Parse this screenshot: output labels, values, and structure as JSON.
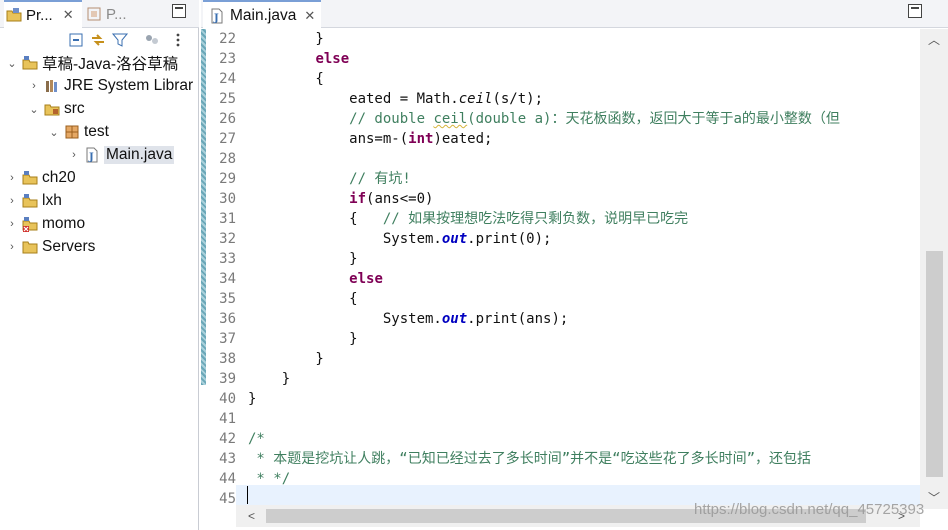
{
  "left_panel": {
    "tabs": [
      {
        "label": "Pr...",
        "icon": "project-explorer-icon",
        "close": "✕"
      },
      {
        "label": "P...",
        "icon": "package-explorer-icon"
      }
    ],
    "toolbar": [
      "collapse-all-icon",
      "link-with-editor-icon",
      "filter-icon",
      "focus-icon",
      "view-menu-icon"
    ],
    "tree": [
      {
        "label": "草稿-Java-洛谷草稿",
        "expanded": true,
        "icon": "java-project-icon"
      },
      {
        "label": "JRE System Librar",
        "expanded": false,
        "icon": "library-icon"
      },
      {
        "label": "src",
        "expanded": true,
        "icon": "source-folder-icon"
      },
      {
        "label": "test",
        "expanded": true,
        "icon": "package-icon"
      },
      {
        "label": "Main.java",
        "expanded": false,
        "icon": "java-file-icon",
        "selected": true
      },
      {
        "label": "ch20",
        "expanded": false,
        "icon": "java-project-icon"
      },
      {
        "label": "lxh",
        "expanded": false,
        "icon": "java-project-icon"
      },
      {
        "label": "momo",
        "expanded": false,
        "icon": "java-project-error-icon"
      },
      {
        "label": "Servers",
        "expanded": false,
        "icon": "folder-icon"
      }
    ]
  },
  "editor": {
    "tab": {
      "label": "Main.java",
      "close": "✕",
      "icon": "java-file-icon"
    },
    "lines": [
      {
        "n": "22",
        "tokens": [
          {
            "t": "        }"
          }
        ]
      },
      {
        "n": "23",
        "tokens": [
          {
            "t": "        "
          },
          {
            "t": "else",
            "c": "kw"
          }
        ]
      },
      {
        "n": "24",
        "tokens": [
          {
            "t": "        {"
          }
        ]
      },
      {
        "n": "25",
        "tokens": [
          {
            "t": "            eated = Math."
          },
          {
            "t": "ceil",
            "c": "it"
          },
          {
            "t": "(s/t);"
          }
        ]
      },
      {
        "n": "26",
        "tokens": [
          {
            "t": "            // double ",
            "c": "cm"
          },
          {
            "t": "ceil",
            "c": "cm sq"
          },
          {
            "t": "(double a)：天花板函数，返回大于等于a的最小整数（但",
            "c": "cm"
          }
        ]
      },
      {
        "n": "27",
        "tokens": [
          {
            "t": "            ans=m-("
          },
          {
            "t": "int",
            "c": "kw"
          },
          {
            "t": ")eated;"
          }
        ]
      },
      {
        "n": "28",
        "tokens": [
          {
            "t": ""
          }
        ]
      },
      {
        "n": "29",
        "tokens": [
          {
            "t": "            // 有坑!",
            "c": "cm"
          }
        ]
      },
      {
        "n": "30",
        "tokens": [
          {
            "t": "            "
          },
          {
            "t": "if",
            "c": "kw"
          },
          {
            "t": "(ans<=0)"
          }
        ]
      },
      {
        "n": "31",
        "tokens": [
          {
            "t": "            {   "
          },
          {
            "t": "// 如果按理想吃法吃得只剩负数，说明早已吃完",
            "c": "cm"
          }
        ]
      },
      {
        "n": "32",
        "tokens": [
          {
            "t": "                System."
          },
          {
            "t": "out",
            "c": "fld"
          },
          {
            "t": ".print(0);"
          }
        ]
      },
      {
        "n": "33",
        "tokens": [
          {
            "t": "            }"
          }
        ]
      },
      {
        "n": "34",
        "tokens": [
          {
            "t": "            "
          },
          {
            "t": "else",
            "c": "kw"
          }
        ]
      },
      {
        "n": "35",
        "tokens": [
          {
            "t": "            {"
          }
        ]
      },
      {
        "n": "36",
        "tokens": [
          {
            "t": "                System."
          },
          {
            "t": "out",
            "c": "fld"
          },
          {
            "t": ".print(ans);"
          }
        ]
      },
      {
        "n": "37",
        "tokens": [
          {
            "t": "            }"
          }
        ]
      },
      {
        "n": "38",
        "tokens": [
          {
            "t": "        }"
          }
        ]
      },
      {
        "n": "39",
        "tokens": [
          {
            "t": "    }"
          }
        ]
      },
      {
        "n": "40",
        "tokens": [
          {
            "t": "}"
          }
        ]
      },
      {
        "n": "41",
        "tokens": [
          {
            "t": ""
          }
        ]
      },
      {
        "n": "42",
        "tokens": [
          {
            "t": "/*",
            "c": "cm"
          }
        ]
      },
      {
        "n": "43",
        "tokens": [
          {
            "t": " * 本题是挖坑让人跳，“已知已经过去了多长时间”并不是“吃这些花了多长时间”，还包括",
            "c": "cm"
          }
        ]
      },
      {
        "n": "44",
        "tokens": [
          {
            "t": " * */",
            "c": "cm"
          }
        ]
      },
      {
        "n": "45",
        "tokens": [
          {
            "t": ""
          }
        ]
      }
    ]
  },
  "watermark": "https://blog.csdn.net/qq_45725393"
}
